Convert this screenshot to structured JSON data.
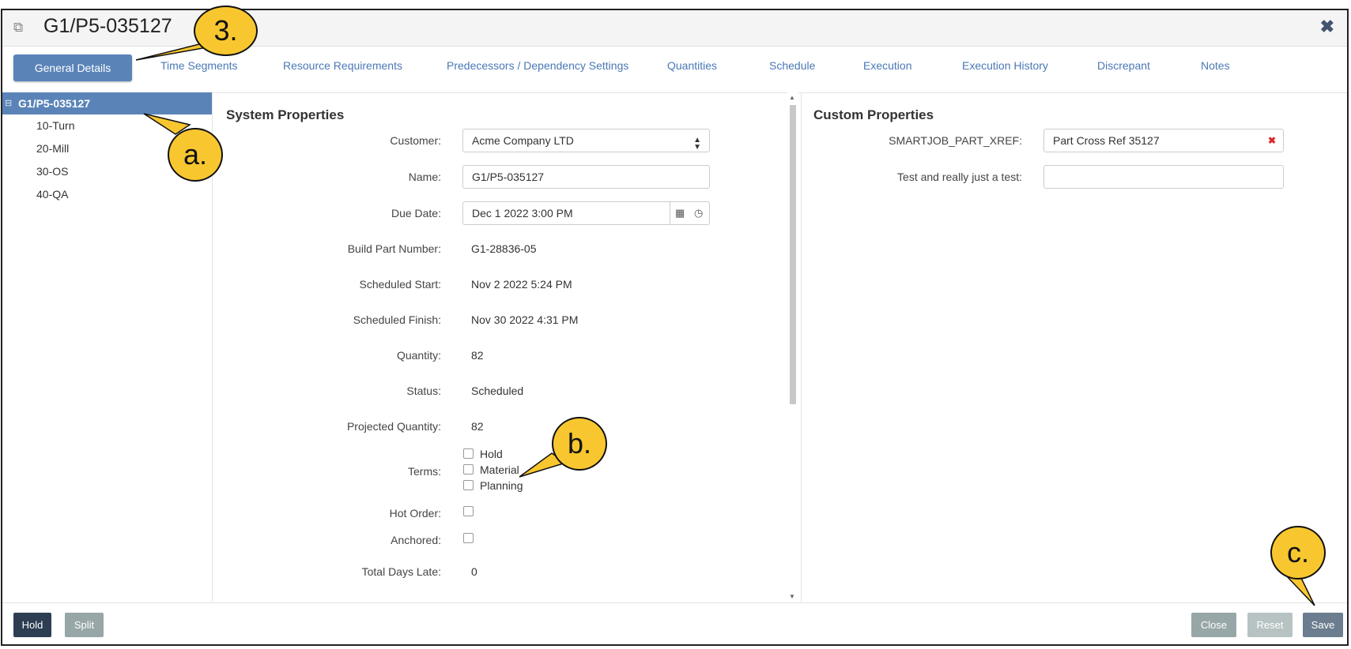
{
  "window": {
    "title": "G1/P5-035127",
    "title_icon": "copy-icon",
    "close_icon": "close-icon"
  },
  "tabs": [
    {
      "label": "General Details",
      "active": true
    },
    {
      "label": "Time Segments"
    },
    {
      "label": "Resource Requirements"
    },
    {
      "label": "Predecessors / Dependency Settings"
    },
    {
      "label": "Quantities"
    },
    {
      "label": "Schedule"
    },
    {
      "label": "Execution"
    },
    {
      "label": "Execution History"
    },
    {
      "label": "Discrepant"
    },
    {
      "label": "Notes"
    }
  ],
  "tree": {
    "expander": "⊟",
    "root": "G1/P5-035127",
    "children": [
      "10-Turn",
      "20-Mill",
      "30-OS",
      "40-QA"
    ]
  },
  "system_properties": {
    "title": "System Properties",
    "customer": {
      "label": "Customer:",
      "value": "Acme Company LTD"
    },
    "name": {
      "label": "Name:",
      "value": "G1/P5-035127"
    },
    "due_date": {
      "label": "Due Date:",
      "value": "Dec 1 2022 3:00 PM"
    },
    "build_part_number": {
      "label": "Build Part Number:",
      "value": "G1-28836-05"
    },
    "scheduled_start": {
      "label": "Scheduled Start:",
      "value": "Nov 2 2022 5:24 PM"
    },
    "scheduled_finish": {
      "label": "Scheduled Finish:",
      "value": "Nov 30 2022 4:31 PM"
    },
    "quantity": {
      "label": "Quantity:",
      "value": "82"
    },
    "status": {
      "label": "Status:",
      "value": "Scheduled"
    },
    "projected_quantity": {
      "label": "Projected Quantity:",
      "value": "82"
    },
    "terms": {
      "label": "Terms:",
      "options": [
        "Hold",
        "Material",
        "Planning"
      ]
    },
    "hot_order": {
      "label": "Hot Order:",
      "checked": false
    },
    "anchored": {
      "label": "Anchored:",
      "checked": false
    },
    "total_days_late": {
      "label": "Total Days Late:",
      "value": "0"
    }
  },
  "custom_properties": {
    "title": "Custom Properties",
    "xref": {
      "label": "SMARTJOB_PART_XREF:",
      "value": "Part Cross Ref 35127"
    },
    "test": {
      "label": "Test and really just a test:",
      "value": ""
    }
  },
  "footer": {
    "hold": "Hold",
    "split": "Split",
    "close": "Close",
    "reset": "Reset",
    "save": "Save"
  },
  "callouts": [
    "3.",
    "a.",
    "b.",
    "c."
  ],
  "colors": {
    "accent": "#5a84b8",
    "tab_text": "#4a78b5",
    "hold_button": "#2d3e52",
    "secondary_button": "#97a6a6",
    "save_button": "#6b7d8e",
    "callout_fill": "#f8c72f"
  }
}
